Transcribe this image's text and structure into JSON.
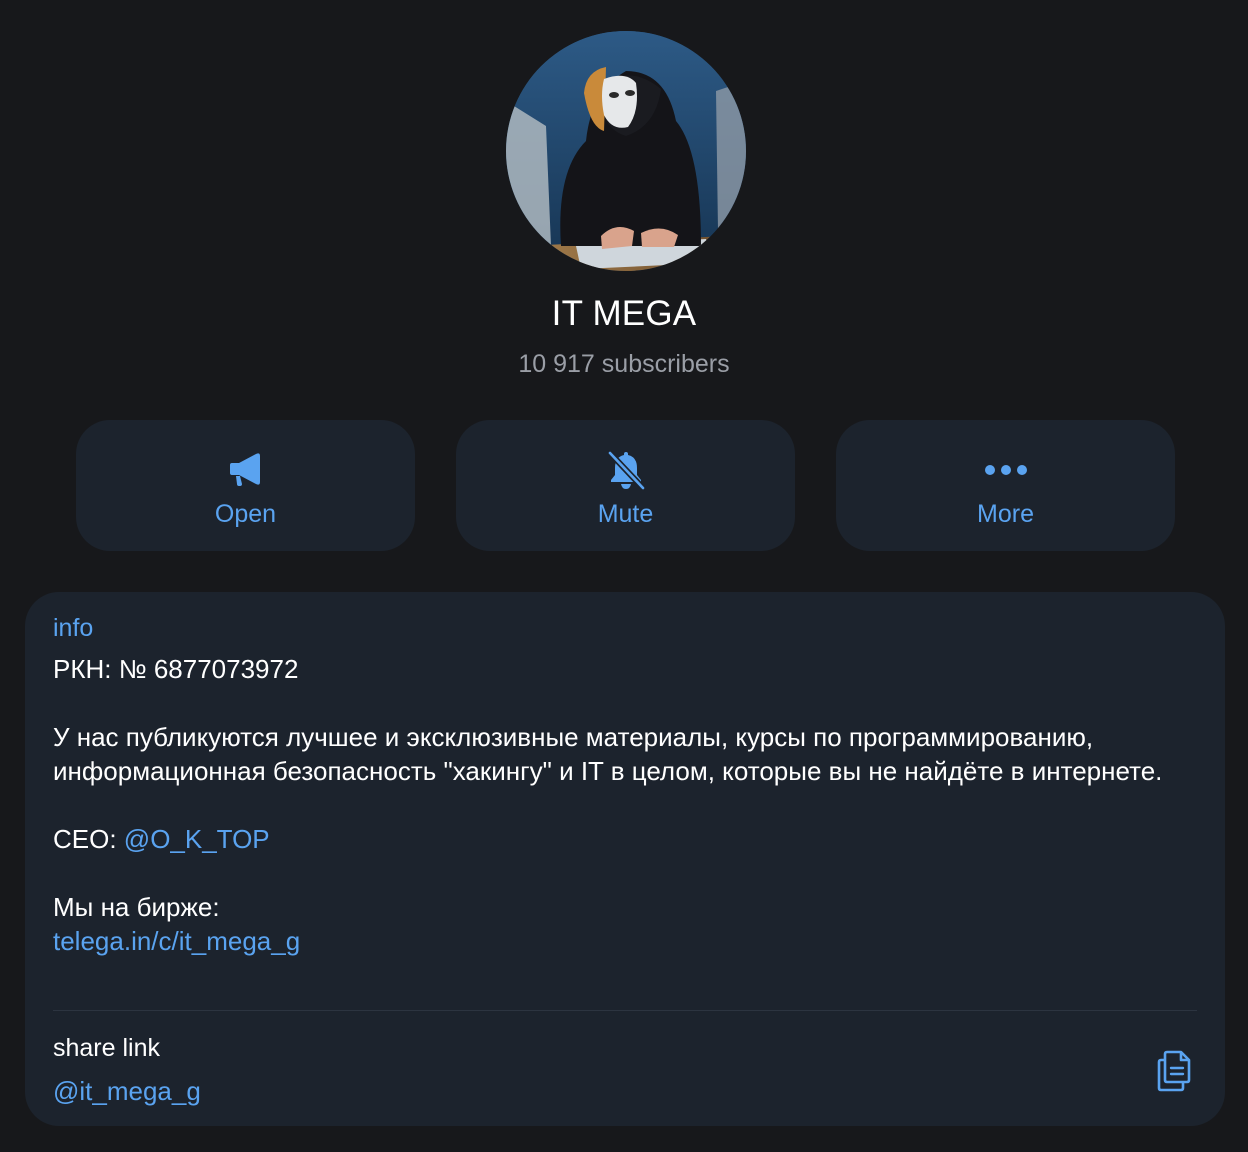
{
  "channel": {
    "title": "IT MEGA",
    "subscribers": "10 917 subscribers",
    "avatar_icon": "avatar-hooded-hacker"
  },
  "actions": [
    {
      "label": "Open",
      "icon": "megaphone-icon"
    },
    {
      "label": "Mute",
      "icon": "bell-slash-icon"
    },
    {
      "label": "More",
      "icon": "ellipsis-icon"
    }
  ],
  "info": {
    "label": "info",
    "rkn": "РКН: № 6877073972",
    "description": "У нас публикуются лучшее и эксклюзивные материалы, курсы по программированию, информационная безопасность \"хакингу\" и IT в целом, которые вы не найдёте в интернете.",
    "ceo_prefix": "CEO: ",
    "ceo_handle": "@O_K_TOP",
    "exchange_text": "Мы на бирже:",
    "exchange_link": "telega.in/c/it_mega_g"
  },
  "share": {
    "label": "share link",
    "handle": "@it_mega_g",
    "copy_icon": "copy-icon"
  },
  "colors": {
    "background": "#17181b",
    "card": "#1c232d",
    "accent": "#5aa3f0",
    "secondary_text": "#9a9ea6"
  }
}
